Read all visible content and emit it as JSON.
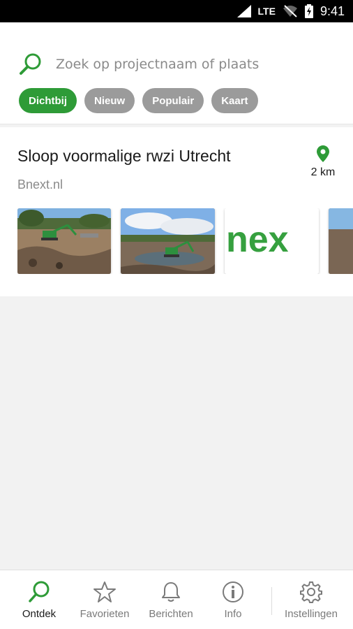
{
  "status_bar": {
    "network": "LTE",
    "time": "9:41"
  },
  "search": {
    "placeholder": "Zoek op projectnaam of plaats",
    "value": ""
  },
  "filters": [
    {
      "label": "Dichtbij",
      "active": true
    },
    {
      "label": "Nieuw",
      "active": false
    },
    {
      "label": "Populair",
      "active": false
    },
    {
      "label": "Kaart",
      "active": false
    }
  ],
  "project": {
    "title": "Sloop voormalige rwzi Utrecht",
    "source": "Bnext.nl",
    "distance": "2 km",
    "photos": [
      {
        "name": "construction-site-photo-1"
      },
      {
        "name": "construction-site-photo-2"
      },
      {
        "name": "bnext-logo-image",
        "logo_text": "nex"
      },
      {
        "name": "construction-site-photo-4"
      }
    ]
  },
  "tabbar": {
    "tabs": [
      {
        "label": "Ontdek",
        "icon": "search-icon",
        "active": true
      },
      {
        "label": "Favorieten",
        "icon": "star-icon",
        "active": false
      },
      {
        "label": "Berichten",
        "icon": "bell-icon",
        "active": false
      },
      {
        "label": "Info",
        "icon": "info-icon",
        "active": false
      },
      {
        "label": "Instellingen",
        "icon": "gear-icon",
        "active": false
      }
    ]
  },
  "colors": {
    "accent": "#2e9b37",
    "chip_inactive": "#9b9b9b",
    "background": "#f2f2f2"
  }
}
